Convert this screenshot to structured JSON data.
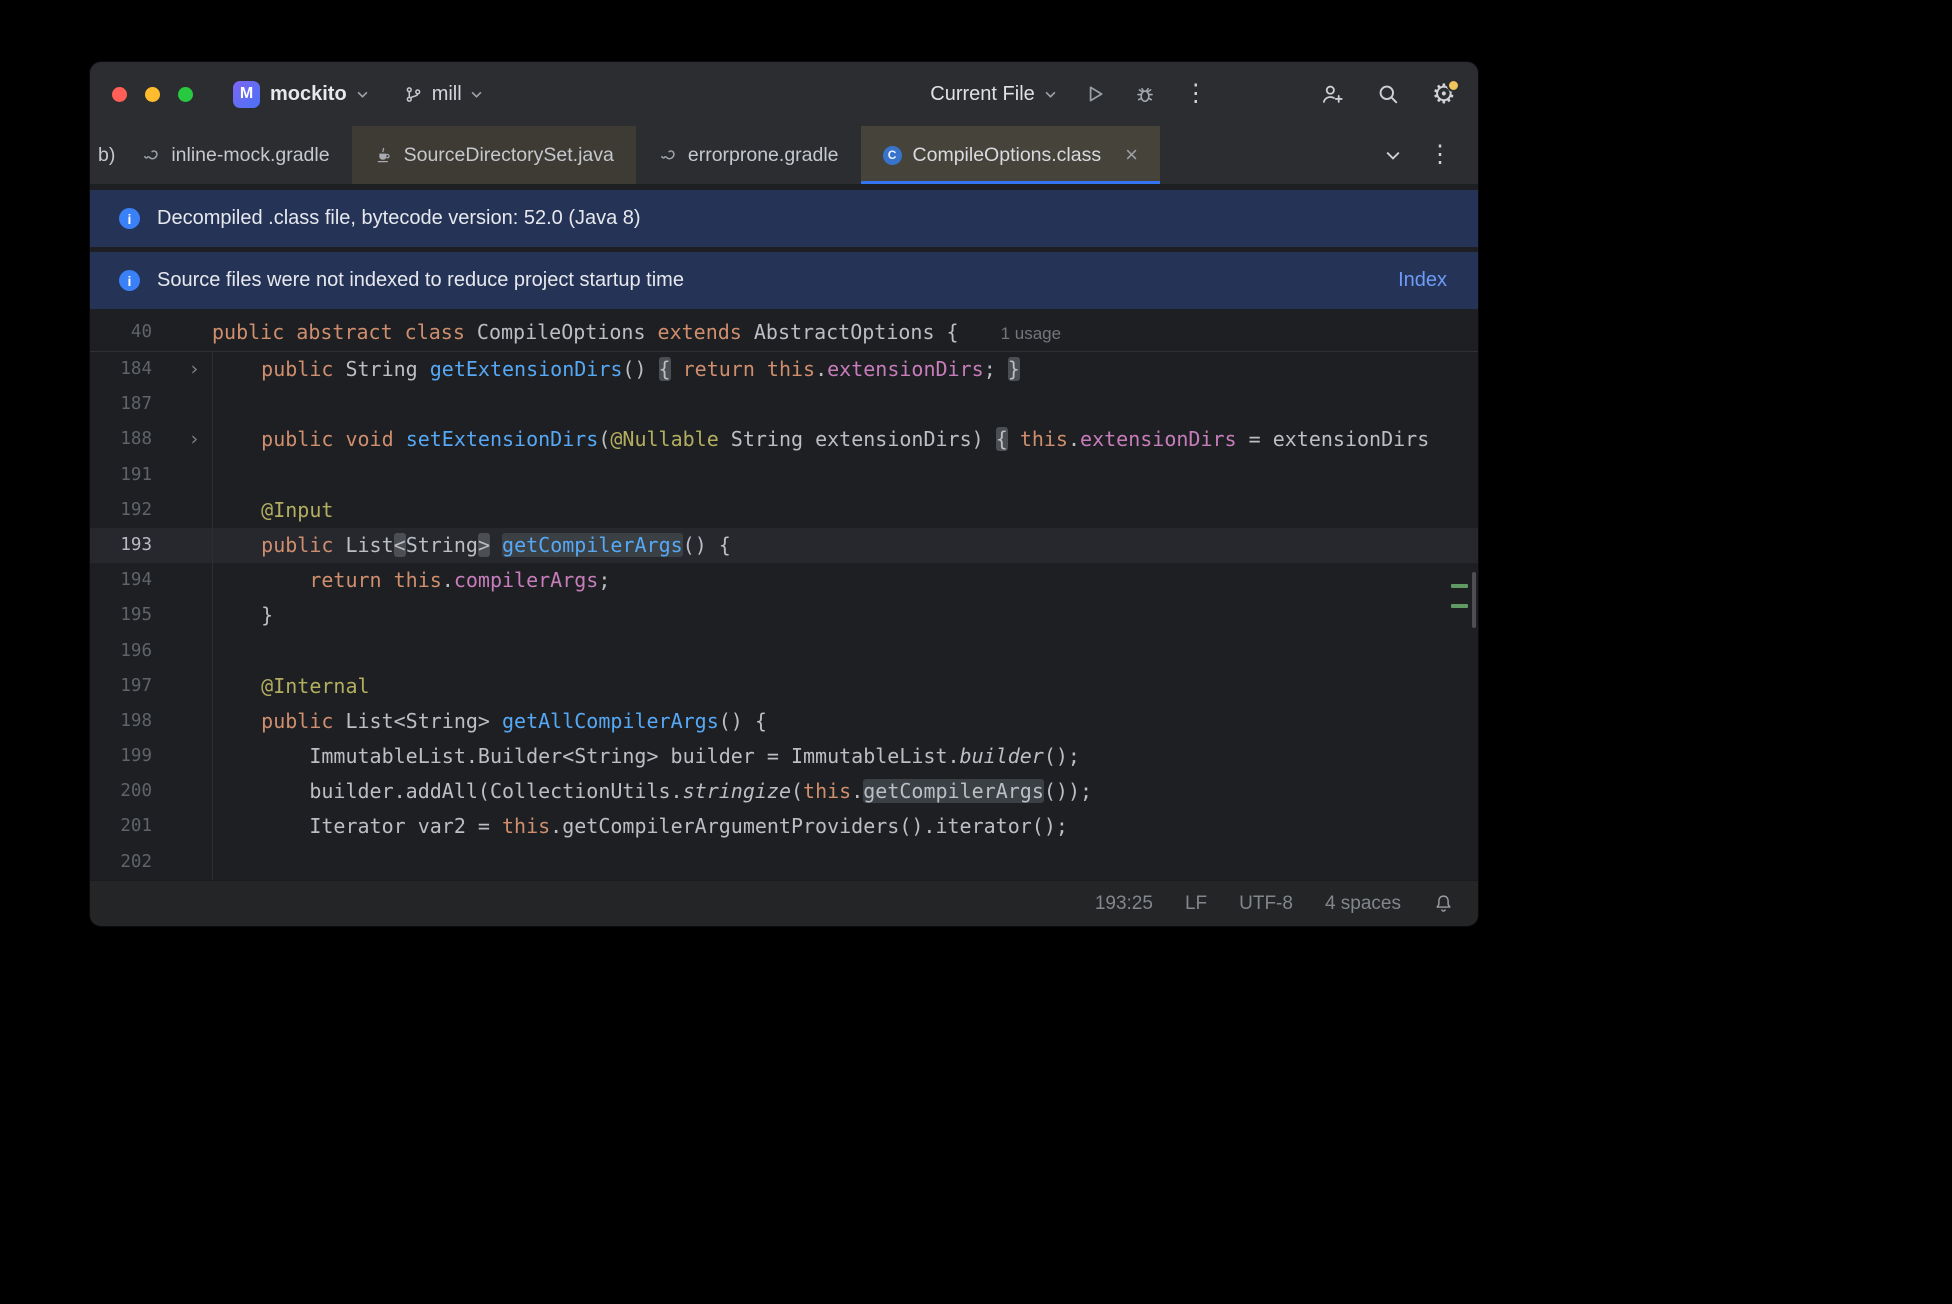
{
  "titlebar": {
    "project": {
      "initial": "M",
      "name": "mockito"
    },
    "branch": "mill",
    "run_config": "Current File"
  },
  "tabs": [
    {
      "label": "b)"
    },
    {
      "label": "inline-mock.gradle",
      "icon": "gradle-icon"
    },
    {
      "label": "SourceDirectorySet.java",
      "icon": "java-icon",
      "tinted": true
    },
    {
      "label": "errorprone.gradle",
      "icon": "gradle-icon"
    },
    {
      "label": "CompileOptions.class",
      "icon": "class-icon",
      "active": true,
      "tinted": true,
      "close": "×"
    }
  ],
  "banners": [
    {
      "text": "Decompiled .class file, bytecode version: 52.0 (Java 8)"
    },
    {
      "text": "Source files were not indexed to reduce project startup time",
      "action": "Index"
    }
  ],
  "editor": {
    "sticky": {
      "num": "40",
      "inlay": "1 usage",
      "seg": [
        {
          "t": "public",
          "c": "kw"
        },
        {
          "t": " "
        },
        {
          "t": "abstract",
          "c": "kw"
        },
        {
          "t": " "
        },
        {
          "t": "class",
          "c": "kw"
        },
        {
          "t": " CompileOptions "
        },
        {
          "t": "extends",
          "c": "kw"
        },
        {
          "t": " AbstractOptions {"
        }
      ]
    },
    "lines": [
      {
        "num": "184",
        "fold": true,
        "seg": [
          {
            "t": "    "
          },
          {
            "t": "public",
            "c": "kw"
          },
          {
            "t": " String "
          },
          {
            "t": "getExtensionDirs",
            "c": "fn"
          },
          {
            "t": "() "
          },
          {
            "t": "{",
            "b": "brace"
          },
          {
            "t": " "
          },
          {
            "t": "return",
            "c": "kw"
          },
          {
            "t": " "
          },
          {
            "t": "this",
            "c": "kw"
          },
          {
            "t": "."
          },
          {
            "t": "extensionDirs",
            "c": "field"
          },
          {
            "t": "; "
          },
          {
            "t": "}",
            "b": "brace"
          }
        ]
      },
      {
        "num": "187",
        "seg": []
      },
      {
        "num": "188",
        "fold": true,
        "seg": [
          {
            "t": "    "
          },
          {
            "t": "public",
            "c": "kw"
          },
          {
            "t": " "
          },
          {
            "t": "void",
            "c": "kw"
          },
          {
            "t": " "
          },
          {
            "t": "setExtensionDirs",
            "c": "fn"
          },
          {
            "t": "("
          },
          {
            "t": "@Nullable",
            "c": "ann"
          },
          {
            "t": " String extensionDirs) "
          },
          {
            "t": "{",
            "b": "brace"
          },
          {
            "t": " "
          },
          {
            "t": "this",
            "c": "kw"
          },
          {
            "t": "."
          },
          {
            "t": "extensionDirs",
            "c": "field"
          },
          {
            "t": " = extensionDirs"
          }
        ]
      },
      {
        "num": "191",
        "seg": []
      },
      {
        "num": "192",
        "seg": [
          {
            "t": "    "
          },
          {
            "t": "@Input",
            "c": "ann"
          }
        ]
      },
      {
        "num": "193",
        "current": true,
        "seg": [
          {
            "t": "    "
          },
          {
            "t": "public",
            "c": "kw"
          },
          {
            "t": " List"
          },
          {
            "t": "<",
            "b": "brace"
          },
          {
            "t": "String"
          },
          {
            "t": ">",
            "b": "brace"
          },
          {
            "t": " "
          },
          {
            "t": "getCompilerArgs",
            "c": "fn",
            "b": "ident"
          },
          {
            "t": "() {"
          }
        ]
      },
      {
        "num": "194",
        "seg": [
          {
            "t": "        "
          },
          {
            "t": "return",
            "c": "kw"
          },
          {
            "t": " "
          },
          {
            "t": "this",
            "c": "kw"
          },
          {
            "t": "."
          },
          {
            "t": "compilerArgs",
            "c": "field"
          },
          {
            "t": ";"
          }
        ]
      },
      {
        "num": "195",
        "seg": [
          {
            "t": "    }"
          }
        ]
      },
      {
        "num": "196",
        "seg": []
      },
      {
        "num": "197",
        "seg": [
          {
            "t": "    "
          },
          {
            "t": "@Internal",
            "c": "ann"
          }
        ]
      },
      {
        "num": "198",
        "seg": [
          {
            "t": "    "
          },
          {
            "t": "public",
            "c": "kw"
          },
          {
            "t": " List<String> "
          },
          {
            "t": "getAllCompilerArgs",
            "c": "fn"
          },
          {
            "t": "() {"
          }
        ]
      },
      {
        "num": "199",
        "seg": [
          {
            "t": "        ImmutableList.Builder<String> builder = ImmutableList."
          },
          {
            "t": "builder",
            "i": true
          },
          {
            "t": "();"
          }
        ]
      },
      {
        "num": "200",
        "seg": [
          {
            "t": "        builder.addAll(CollectionUtils."
          },
          {
            "t": "stringize",
            "i": true
          },
          {
            "t": "("
          },
          {
            "t": "this",
            "c": "kw"
          },
          {
            "t": "."
          },
          {
            "t": "getCompilerArgs",
            "b": "ident"
          },
          {
            "t": "());"
          }
        ]
      },
      {
        "num": "201",
        "seg": [
          {
            "t": "        Iterator var2 = "
          },
          {
            "t": "this",
            "c": "kw"
          },
          {
            "t": ".getCompilerArgumentProviders().iterator();"
          }
        ]
      },
      {
        "num": "202",
        "seg": []
      }
    ]
  },
  "statusbar": {
    "position": "193:25",
    "line_ending": "LF",
    "encoding": "UTF-8",
    "indent": "4 spaces"
  },
  "colors": {
    "accent": "#3574f0",
    "keyword": "#cf8e6d",
    "method": "#56a8f5",
    "field": "#c77dbb",
    "annotation": "#b3ae60",
    "text": "#bcbec4",
    "banner_bg": "#253456",
    "editor_bg": "#1e1f22",
    "chrome_bg": "#2b2d30"
  }
}
